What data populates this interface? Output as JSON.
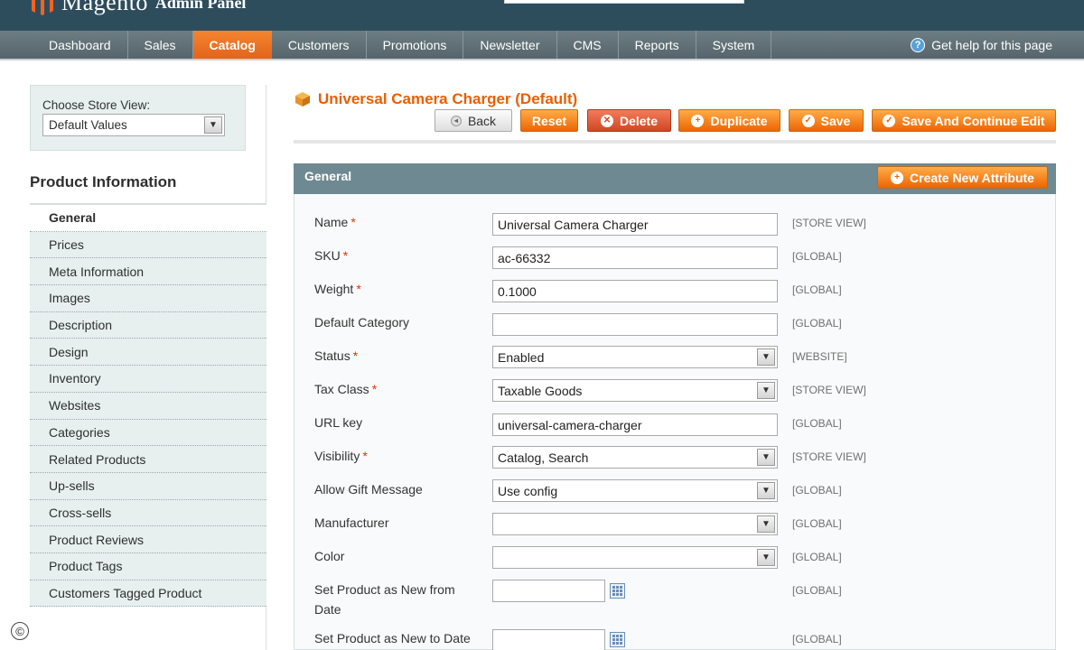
{
  "header": {
    "logo_text": "Magento",
    "logo_sub": "Admin Panel"
  },
  "nav": {
    "items": [
      {
        "label": "Dashboard"
      },
      {
        "label": "Sales"
      },
      {
        "label": "Catalog"
      },
      {
        "label": "Customers"
      },
      {
        "label": "Promotions"
      },
      {
        "label": "Newsletter"
      },
      {
        "label": "CMS"
      },
      {
        "label": "Reports"
      },
      {
        "label": "System"
      }
    ],
    "active": "Catalog",
    "help_label": "Get help for this page",
    "help_icon": "help-icon"
  },
  "store_view": {
    "label": "Choose Store View:",
    "selected": "Default Values"
  },
  "product_info": {
    "title": "Product Information",
    "tabs": [
      "General",
      "Prices",
      "Meta Information",
      "Images",
      "Description",
      "Design",
      "Inventory",
      "Websites",
      "Categories",
      "Related Products",
      "Up-sells",
      "Cross-sells",
      "Product Reviews",
      "Product Tags",
      "Customers Tagged Product"
    ],
    "active_tab": "General"
  },
  "page": {
    "title": "Universal Camera Charger (Default)",
    "buttons": {
      "back": "Back",
      "reset": "Reset",
      "delete": "Delete",
      "duplicate": "Duplicate",
      "save": "Save",
      "save_continue": "Save And Continue Edit"
    }
  },
  "fieldset": {
    "title": "General",
    "create_attribute": "Create New Attribute",
    "rows": [
      {
        "label": "Name",
        "required": "*",
        "value": "Universal Camera Charger",
        "scope": "[STORE VIEW]"
      },
      {
        "label": "SKU",
        "required": "*",
        "value": "ac-66332",
        "scope": "[GLOBAL]"
      },
      {
        "label": "Weight",
        "required": "*",
        "value": "0.1000",
        "scope": "[GLOBAL]"
      },
      {
        "label": "Default Category",
        "required": "",
        "value": "",
        "scope": "[GLOBAL]"
      },
      {
        "label": "Status",
        "required": "*",
        "value": "Enabled",
        "scope": "[WEBSITE]"
      },
      {
        "label": "Tax Class",
        "required": "*",
        "value": "Taxable Goods",
        "scope": "[STORE VIEW]"
      },
      {
        "label": "URL key",
        "required": "",
        "value": "universal-camera-charger",
        "scope": "[GLOBAL]"
      },
      {
        "label": "Visibility",
        "required": "*",
        "value": "Catalog, Search",
        "scope": "[STORE VIEW]"
      },
      {
        "label": "Allow Gift Message",
        "required": "",
        "value": "Use config",
        "scope": "[GLOBAL]"
      },
      {
        "label": "Manufacturer",
        "required": "",
        "value": "",
        "scope": "[GLOBAL]"
      },
      {
        "label": "Color",
        "required": "",
        "value": "",
        "scope": "[GLOBAL]"
      },
      {
        "label": "Set Product as New from Date",
        "required": "",
        "value": "",
        "scope": "[GLOBAL]"
      },
      {
        "label": "Set Product as New to Date",
        "required": "",
        "value": "",
        "scope": "[GLOBAL]"
      }
    ]
  },
  "footer": {
    "copyright_symbol": "©"
  },
  "colors": {
    "accent_orange": "#eb5e00",
    "nav_active": "#f0711f",
    "header_bg": "#2e4d5c",
    "fieldset_head": "#6f8992",
    "required": "#eb2f00"
  }
}
